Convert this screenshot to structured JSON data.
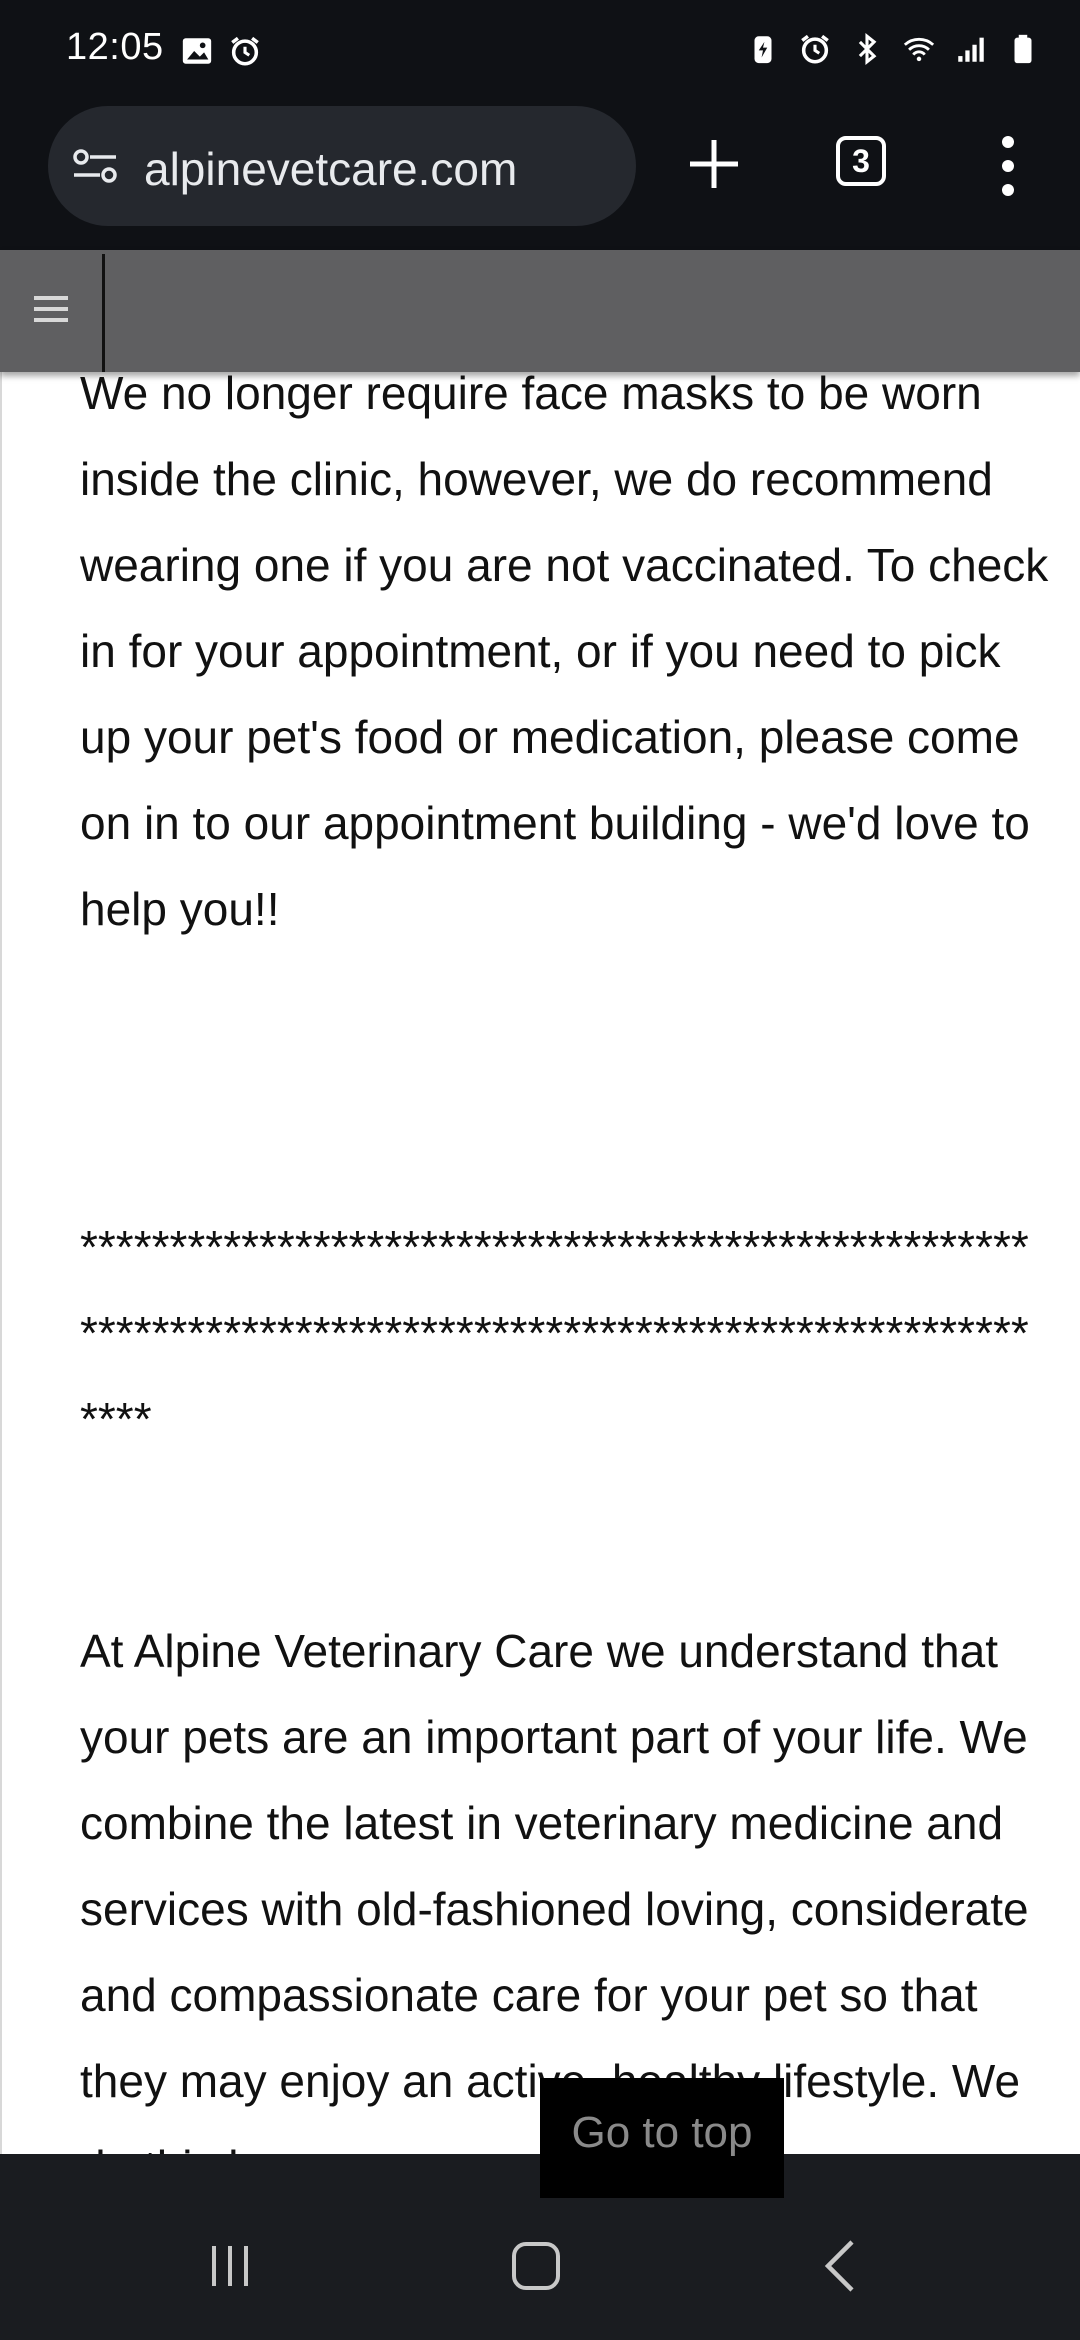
{
  "status_bar": {
    "time": "12:05",
    "left_icons": [
      "image-icon",
      "alarm-icon"
    ],
    "right_icons": [
      "battery-saver-icon",
      "alarm-icon",
      "bluetooth-icon",
      "wifi-icon",
      "signal-icon",
      "battery-icon"
    ]
  },
  "browser": {
    "url": "alpinevetcare.com",
    "tab_count": "3",
    "icons": [
      "site-settings-icon",
      "plus-icon",
      "more-vert-icon"
    ]
  },
  "site_nav": {
    "menu_icon": "hamburger-icon"
  },
  "content": {
    "paragraph_1": "We no longer require face masks to be worn inside the clinic, however, we do recommend wearing one if you are not vaccinated. To check in for your appointment, or if you need to pick up your pet's food or medication, please come on in to our appointment building - we'd love to help you!!",
    "stars": "**************************************************************************************************************",
    "paragraph_2": "At Alpine Veterinary Care we understand that your pets are an important part of your life. We combine the latest in veterinary medicine and services with old-fashioned loving, considerate and compassionate care for your pet so that they may enjoy an active, healthy lifestyle. We do this by"
  },
  "go_to_top": {
    "label": "Go to top"
  },
  "system_nav": {
    "buttons": [
      "recents-icon",
      "home-icon",
      "back-icon"
    ]
  }
}
